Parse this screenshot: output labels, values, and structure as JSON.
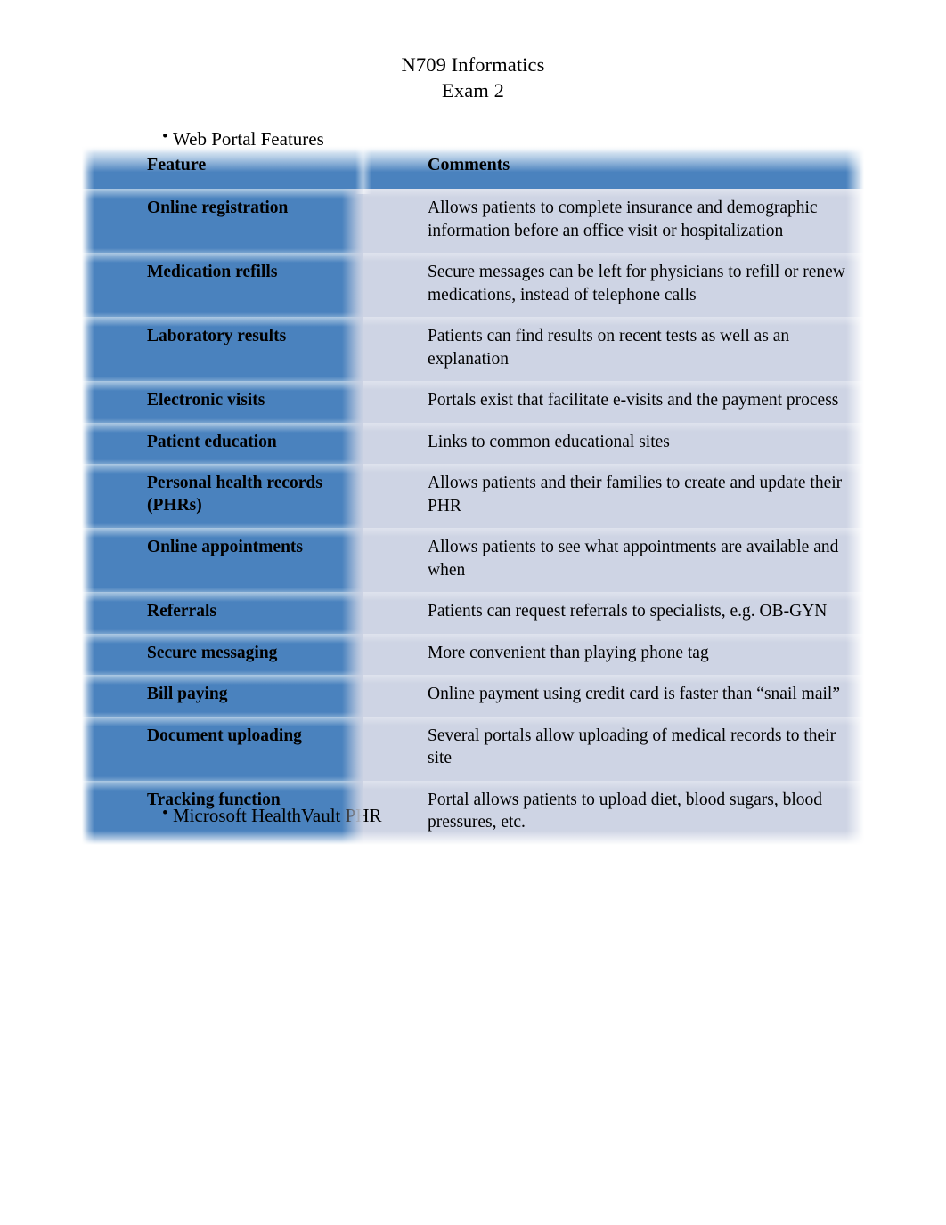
{
  "header": {
    "line1": "N709 Informatics",
    "line2": "Exam 2"
  },
  "bullets": {
    "marker": "•",
    "top": "Web Portal Features",
    "bottom": "Microsoft HealthVault PHR"
  },
  "colors": {
    "table_blue": "#4A82BE",
    "table_light": "#CED4E4",
    "page_background": "#FFFFFF",
    "text": "#000000"
  },
  "table": {
    "columns": [
      "Feature",
      "Comments"
    ],
    "rows": [
      {
        "feature": "Online registration",
        "comments": "Allows patients to complete insurance and demographic information before an office visit or hospitalization"
      },
      {
        "feature": "Medication refills",
        "comments": "Secure messages can be left for physicians to refill or renew medications, instead of telephone calls"
      },
      {
        "feature": "Laboratory results",
        "comments": "Patients can find results on recent tests as well as an explanation"
      },
      {
        "feature": "Electronic visits",
        "comments": "Portals exist that facilitate e-visits and the payment process"
      },
      {
        "feature": "Patient education",
        "comments": "Links to common educational sites"
      },
      {
        "feature": "Personal health records (PHRs)",
        "comments": "Allows patients and their families to create and update their PHR"
      },
      {
        "feature": "Online appointments",
        "comments": "Allows patients to see what appointments are available and when"
      },
      {
        "feature": "Referrals",
        "comments": "Patients can request referrals to specialists, e.g.  OB-GYN"
      },
      {
        "feature": "Secure messaging",
        "comments": "More convenient than playing phone tag"
      },
      {
        "feature": "Bill paying",
        "comments": "Online payment using credit card is faster than “snail mail”"
      },
      {
        "feature": "Document uploading",
        "comments": "Several portals allow uploading of medical records to their site"
      },
      {
        "feature": "Tracking function",
        "comments": "Portal allows patients to upload diet, blood sugars, blood pressures, etc."
      }
    ]
  }
}
